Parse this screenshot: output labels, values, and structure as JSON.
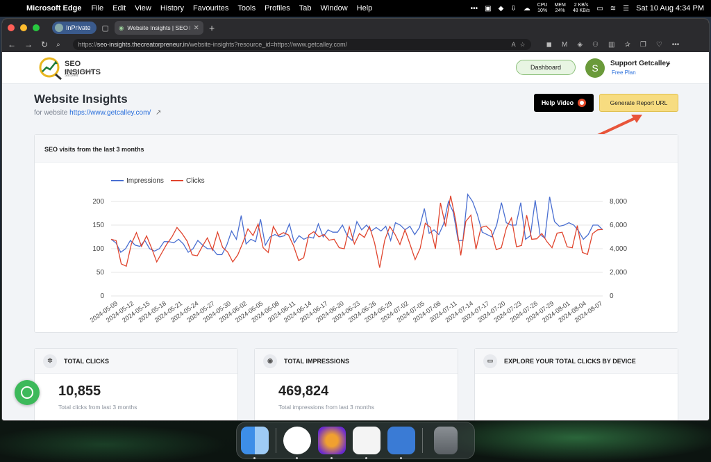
{
  "menubar": {
    "app_name": "Microsoft Edge",
    "menus": [
      "File",
      "Edit",
      "View",
      "History",
      "Favourites",
      "Tools",
      "Profiles",
      "Tab",
      "Window",
      "Help"
    ],
    "cpu_label": "CPU",
    "cpu_value": "10%",
    "mem_label": "MEM",
    "mem_value": "24%",
    "net_up": "2 KB/s",
    "net_down": "48 KB/s",
    "datetime": "Sat 10 Aug  4:34 PM"
  },
  "browser": {
    "inprivate_label": "InPrivate",
    "tab_title": "Website Insights | SEO Insight",
    "url_prefix": "https://",
    "url_host": "seo-insights.thecreatorpreneur.in",
    "url_path": "/website-insights?resource_id=https://www.getcalley.com/"
  },
  "header": {
    "logo_text": "SEO INSIGHTS",
    "logo_tagline": "Optimize. Analyze. Succeed",
    "dashboard_label": "Dashboard",
    "user_initial": "S",
    "user_name": "Support Getcalley",
    "user_plan": "Free Plan"
  },
  "main": {
    "title": "Website Insights",
    "subtitle_prefix": "for website",
    "website_url": "https://www.getcalley.com/",
    "help_video_label": "Help Video",
    "generate_report_label": "Generate Report URL"
  },
  "chart_card": {
    "heading": "SEO visits from the last 3 months"
  },
  "chart_data": {
    "type": "line",
    "legend": "top-left",
    "series": [
      {
        "name": "Impressions",
        "color": "#4a6fd1",
        "axis": "right",
        "values": [
          4800,
          4500,
          3700,
          4000,
          4700,
          4300,
          4200,
          4700,
          4000,
          3800,
          4000,
          4600,
          4600,
          4500,
          4800,
          4400,
          3700,
          4000,
          4700,
          4300,
          4000,
          4000,
          3500,
          3500,
          4300,
          5500,
          4800,
          6800,
          4400,
          4800,
          4600,
          6500,
          4300,
          5000,
          5200,
          5000,
          5100,
          6100,
          4500,
          5100,
          4800,
          5000,
          4900,
          6100,
          5000,
          5600,
          5400,
          5400,
          6000,
          5100,
          4700,
          6300,
          5600,
          6000,
          5500,
          5800,
          5500,
          5900,
          4700,
          6200,
          6000,
          5600,
          5900,
          5200,
          5800,
          7400,
          5300,
          5600,
          5200,
          6100,
          8000,
          7100,
          4700,
          4700,
          8600,
          8000,
          6900,
          5400,
          5200,
          5000,
          6000,
          7900,
          6200,
          6000,
          6000,
          7900,
          4800,
          5100,
          8100,
          5200,
          4900,
          8400,
          6300,
          5900,
          6000,
          6200,
          6000,
          5500,
          4800,
          5200,
          6000,
          6000,
          5600
        ]
      },
      {
        "name": "Clicks",
        "color": "#e0452e",
        "axis": "left",
        "values": [
          120,
          117,
          68,
          63,
          110,
          134,
          105,
          127,
          101,
          72,
          91,
          110,
          125,
          145,
          132,
          116,
          87,
          85,
          105,
          123,
          97,
          135,
          103,
          93,
          72,
          87,
          113,
          142,
          128,
          152,
          102,
          92,
          147,
          128,
          134,
          129,
          106,
          75,
          81,
          129,
          136,
          125,
          130,
          118,
          120,
          102,
          100,
          146,
          110,
          132,
          124,
          147,
          112,
          60,
          118,
          147,
          131,
          109,
          140,
          109,
          77,
          101,
          154,
          145,
          100,
          197,
          147,
          212,
          160,
          86,
          158,
          171,
          99,
          145,
          148,
          138,
          98,
          102,
          144,
          165,
          104,
          107,
          171,
          120,
          121,
          132,
          115,
          102,
          133,
          135,
          104,
          102,
          149,
          92,
          88,
          132,
          140,
          141
        ]
      }
    ],
    "x_ticks": [
      "2024-05-09",
      "2024-05-12",
      "2024-05-15",
      "2024-05-18",
      "2024-05-21",
      "2024-05-24",
      "2024-05-27",
      "2024-05-30",
      "2024-06-02",
      "2024-06-05",
      "2024-06-08",
      "2024-06-11",
      "2024-06-14",
      "2024-06-17",
      "2024-06-20",
      "2024-06-23",
      "2024-06-26",
      "2024-06-29",
      "2024-07-02",
      "2024-07-05",
      "2024-07-08",
      "2024-07-11",
      "2024-07-14",
      "2024-07-17",
      "2024-07-20",
      "2024-07-23",
      "2024-07-26",
      "2024-07-29",
      "2024-08-01",
      "2024-08-04",
      "2024-08-07"
    ],
    "y_left": {
      "ticks": [
        "0",
        "50",
        "100",
        "150",
        "200"
      ],
      "range": [
        0,
        200
      ]
    },
    "y_right": {
      "ticks": [
        "0",
        "2,000",
        "4,000",
        "6,000",
        "8,000"
      ],
      "range": [
        0,
        8000
      ]
    }
  },
  "stats": [
    {
      "icon": "cursor-click-icon",
      "heading": "TOTAL CLICKS",
      "value": "10,855",
      "caption": "Total clicks from last 3 months"
    },
    {
      "icon": "eye-icon",
      "heading": "TOTAL IMPRESSIONS",
      "value": "469,824",
      "caption": "Total impressions from last 3 months"
    },
    {
      "icon": "devices-icon",
      "heading": "EXPLORE YOUR TOTAL CLICKS BY DEVICE"
    }
  ],
  "colors": {
    "accent": "#2a6fdb",
    "generate_button": "#f7dc80",
    "whatsapp": "#3cb95a"
  }
}
